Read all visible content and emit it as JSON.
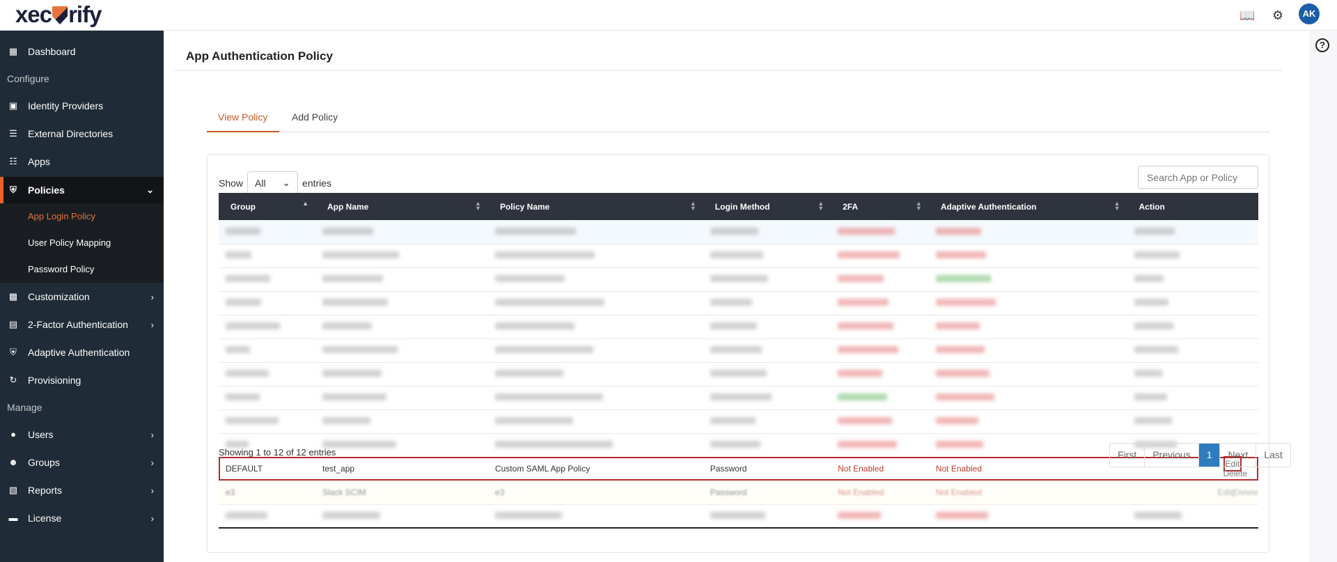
{
  "brand": {
    "logo_text_left": "xec",
    "logo_text_right": "rify"
  },
  "topbar": {
    "avatar": "AK",
    "icons": [
      "book-icon",
      "gear-icon"
    ]
  },
  "sidebar": {
    "dashboard": "Dashboard",
    "configure": "Configure",
    "identity_providers": "Identity Providers",
    "external_directories": "External Directories",
    "apps": "Apps",
    "policies": "Policies",
    "sub": [
      "App Login Policy",
      "User Policy Mapping",
      "Password Policy"
    ],
    "customization": "Customization",
    "two_factor": "2-Factor Authentication",
    "adaptive": "Adaptive Authentication",
    "provisioning": "Provisioning",
    "manage": "Manage",
    "users": "Users",
    "groups": "Groups",
    "reports": "Reports",
    "license": "License"
  },
  "page": {
    "title": "App Authentication Policy"
  },
  "tabs": [
    {
      "label": "View Policy",
      "active": true
    },
    {
      "label": "Add Policy",
      "active": false
    }
  ],
  "table_controls": {
    "show": "Show",
    "entries": "entries",
    "page_size": "All",
    "search_placeholder": "Search App or Policy"
  },
  "columns": [
    "Group",
    "App Name",
    "Policy Name",
    "Login Method",
    "2FA",
    "Adaptive Authentication",
    "Action"
  ],
  "rows": [
    {
      "group": "DEFAULT",
      "app": "test_app",
      "policy": "Custom SAML App Policy",
      "login": "Password",
      "twofa": "Not Enabled",
      "adaptive": "Not Enabled",
      "edit": "Edit",
      "delete": "Delete"
    },
    {
      "group": "e3",
      "app": "Slack SCIM",
      "policy": "e3",
      "login": "Password",
      "twofa": "Not Enabled",
      "adaptive": "Not Enabled",
      "edit": "Edit",
      "sep": "|",
      "delete": "Delete"
    }
  ],
  "footer": {
    "showing": "Showing 1 to 12 of 12 entries",
    "pager": {
      "first": "First",
      "previous": "Previous",
      "current": "1",
      "next": "Next",
      "last": "Last"
    }
  },
  "colors": {
    "accent": "#c55a24",
    "sidebar": "#1f2b36",
    "table_header": "#2e333d",
    "highlight": "#b52a2a",
    "pager_active": "#2e7bbd"
  }
}
